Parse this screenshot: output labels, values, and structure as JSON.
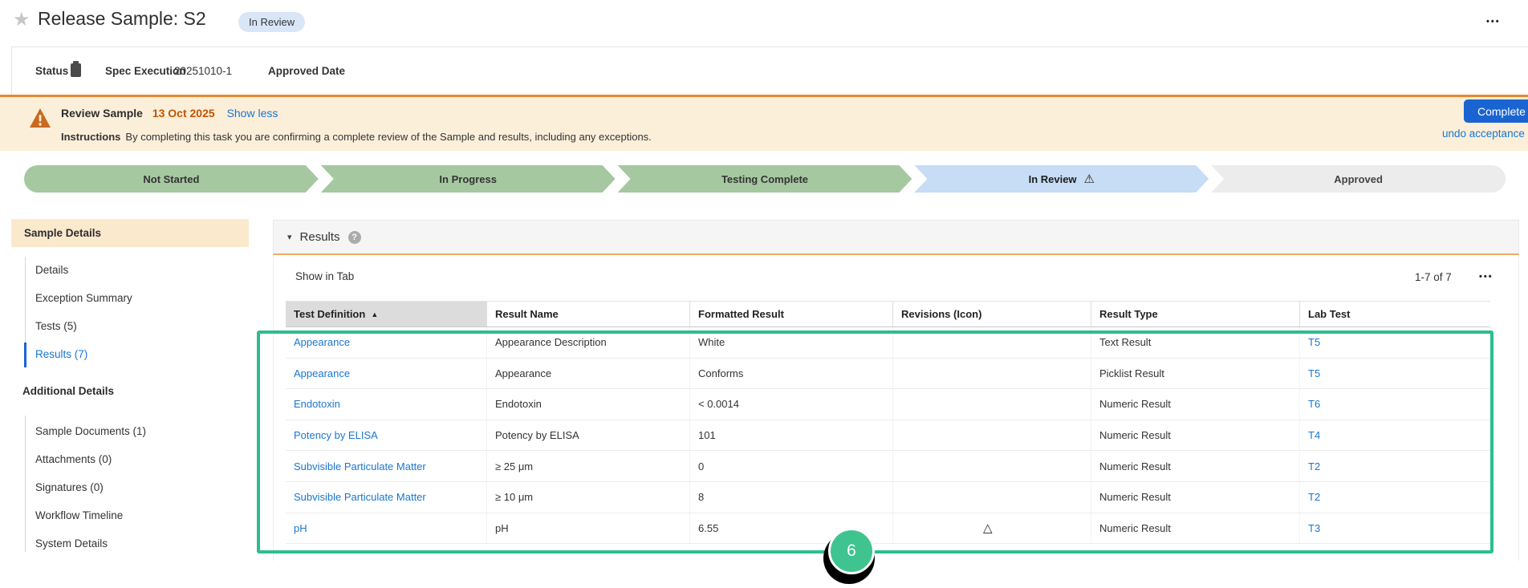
{
  "header": {
    "title": "Release Sample: S2",
    "status_badge": "In Review"
  },
  "meta_bar": {
    "status_label": "Status",
    "spec_execution_label": "Spec Execution",
    "spec_execution_value": "20251010-1",
    "approved_date_label": "Approved Date"
  },
  "task_banner": {
    "task_name": "Review Sample",
    "due_date": "13 Oct 2025",
    "toggle_link": "Show less",
    "instructions_label": "Instructions",
    "instructions_text": "By completing this task you are confirming a complete review of the Sample and results, including any exceptions.",
    "complete_button": "Complete",
    "undo_link": "undo acceptance"
  },
  "workflow_stages": [
    {
      "label": "Not Started",
      "state": "done"
    },
    {
      "label": "In Progress",
      "state": "done"
    },
    {
      "label": "Testing Complete",
      "state": "done"
    },
    {
      "label": "In Review",
      "state": "current",
      "warning": true
    },
    {
      "label": "Approved",
      "state": "pending"
    }
  ],
  "sidebar": {
    "section1": {
      "title": "Sample Details",
      "items": [
        {
          "label": "Details"
        },
        {
          "label": "Exception Summary"
        },
        {
          "label": "Tests (5)"
        },
        {
          "label": "Results (7)",
          "selected": true
        }
      ]
    },
    "section2": {
      "title": "Additional Details",
      "items": [
        {
          "label": "Sample Documents (1)"
        },
        {
          "label": "Attachments (0)"
        },
        {
          "label": "Signatures (0)"
        },
        {
          "label": "Workflow Timeline"
        },
        {
          "label": "System Details"
        }
      ]
    }
  },
  "results_section": {
    "title": "Results",
    "show_in_tab": "Show in Tab",
    "pagination": "1-7 of 7",
    "sorted_column": "Test Definition",
    "sort_direction": "ascending",
    "columns": [
      "Test Definition",
      "Result Name",
      "Formatted Result",
      "Revisions (Icon)",
      "Result Type",
      "Lab Test"
    ],
    "rows": [
      {
        "test_definition": "Appearance",
        "result_name": "Appearance Description",
        "formatted_result": "White",
        "revisions": "",
        "result_type": "Text Result",
        "lab_test": "T5"
      },
      {
        "test_definition": "Appearance",
        "result_name": "Appearance",
        "formatted_result": "Conforms",
        "revisions": "",
        "result_type": "Picklist Result",
        "lab_test": "T5"
      },
      {
        "test_definition": "Endotoxin",
        "result_name": "Endotoxin",
        "formatted_result": "< 0.0014",
        "revisions": "",
        "result_type": "Numeric Result",
        "lab_test": "T6"
      },
      {
        "test_definition": "Potency by ELISA",
        "result_name": "Potency by ELISA",
        "formatted_result": "101",
        "revisions": "",
        "result_type": "Numeric Result",
        "lab_test": "T4"
      },
      {
        "test_definition": "Subvisible Particulate Matter",
        "result_name": "≥ 25 μm",
        "formatted_result": "0",
        "revisions": "",
        "result_type": "Numeric Result",
        "lab_test": "T2"
      },
      {
        "test_definition": "Subvisible Particulate Matter",
        "result_name": "≥ 10 μm",
        "formatted_result": "8",
        "revisions": "",
        "result_type": "Numeric Result",
        "lab_test": "T2"
      },
      {
        "test_definition": "pH",
        "result_name": "pH",
        "formatted_result": "6.55",
        "revisions": "△",
        "result_type": "Numeric Result",
        "lab_test": "T3"
      }
    ]
  },
  "annotation": {
    "step_badge": "6"
  },
  "icons": {
    "star": "★",
    "more_menu": "•••",
    "warning_outline": "⚠",
    "collapse": "▾",
    "help": "?",
    "sort_asc": "▲",
    "revision_triangle": "△"
  },
  "colors": {
    "accent_blue": "#1976d2",
    "button_blue": "#1a64d2",
    "banner_bg": "#fcefda",
    "banner_border": "#e8872e",
    "date_orange": "#c25400",
    "stage_done_green": "#a5c8a0",
    "stage_current_blue": "#c7dcf5",
    "stage_pending_gray": "#ececec",
    "sidebar_highlight": "#fbe9ce",
    "sorted_header_gray": "#dcdcdc",
    "highlight_green": "#2cbe8c",
    "badge_green": "#3fc48f"
  }
}
